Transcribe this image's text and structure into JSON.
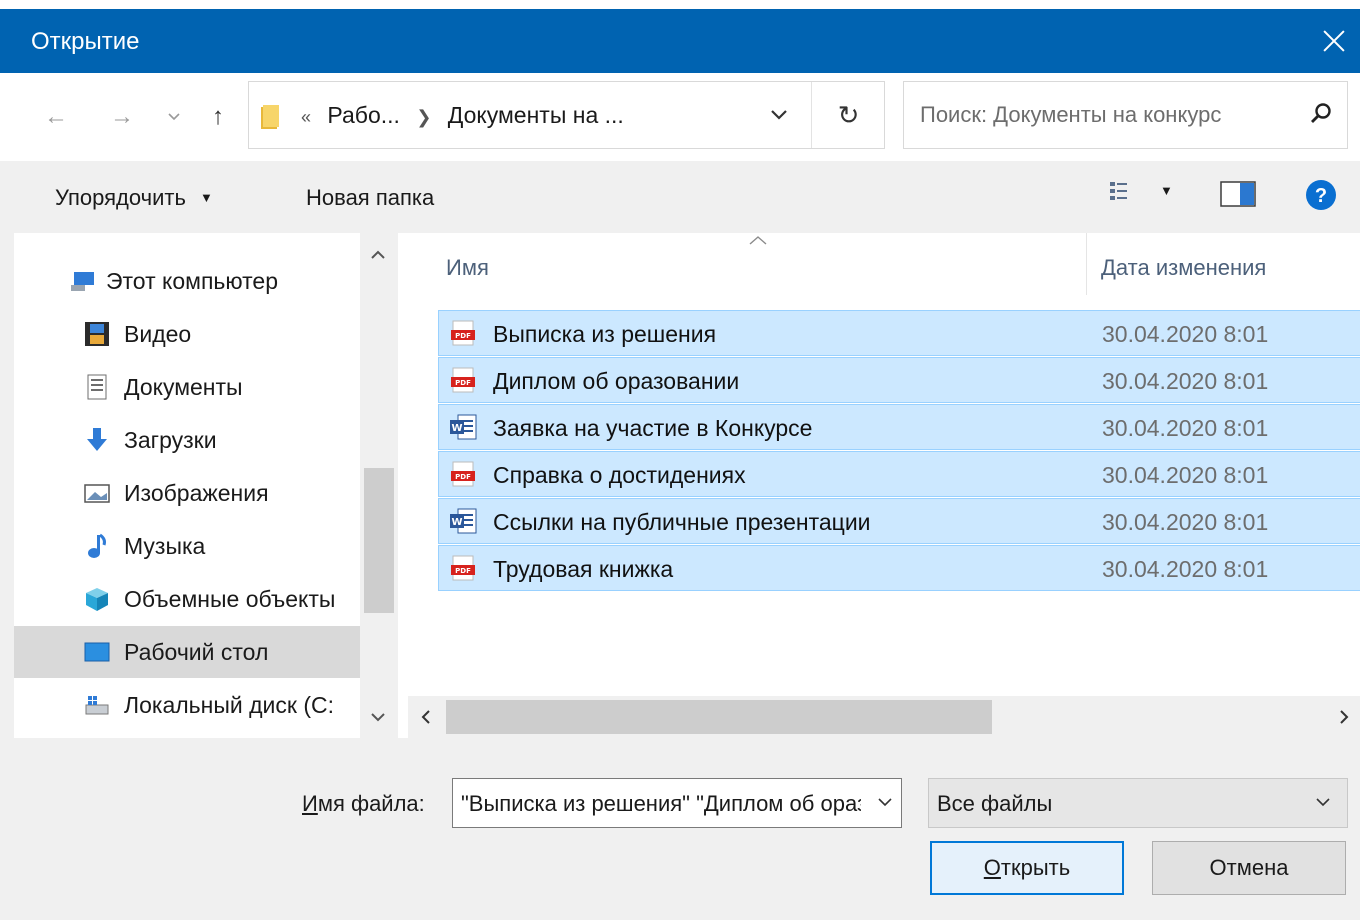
{
  "window": {
    "title": "Открытие"
  },
  "address": {
    "overflow": "«",
    "crumbs": [
      "Рабо...",
      "Документы на ..."
    ]
  },
  "search": {
    "placeholder": "Поиск: Документы на конкурс"
  },
  "toolbar": {
    "organize": "Упорядочить",
    "new_folder": "Новая папка"
  },
  "sidebar": {
    "items": [
      {
        "label": "Этот компьютер",
        "icon": "computer-icon"
      },
      {
        "label": "Видео",
        "icon": "video-icon"
      },
      {
        "label": "Документы",
        "icon": "documents-icon"
      },
      {
        "label": "Загрузки",
        "icon": "downloads-icon"
      },
      {
        "label": "Изображения",
        "icon": "pictures-icon"
      },
      {
        "label": "Музыка",
        "icon": "music-icon"
      },
      {
        "label": "Объемные объекты",
        "icon": "3d-objects-icon"
      },
      {
        "label": "Рабочий стол",
        "icon": "desktop-icon",
        "selected": true
      },
      {
        "label": "Локальный диск (C:",
        "icon": "local-disk-icon"
      }
    ]
  },
  "columns": {
    "name": "Имя",
    "date": "Дата изменения"
  },
  "files": [
    {
      "name": "Выписка из решения",
      "date": "30.04.2020 8:01",
      "type": "pdf"
    },
    {
      "name": "Диплом об оразовании",
      "date": "30.04.2020 8:01",
      "type": "pdf"
    },
    {
      "name": "Заявка на участие в Конкурсе",
      "date": "30.04.2020 8:01",
      "type": "word"
    },
    {
      "name": "Справка о достидениях",
      "date": "30.04.2020 8:01",
      "type": "pdf"
    },
    {
      "name": "Ссылки на публичные презентации",
      "date": "30.04.2020 8:01",
      "type": "word"
    },
    {
      "name": "Трудовая книжка",
      "date": "30.04.2020 8:01",
      "type": "pdf"
    }
  ],
  "footer": {
    "filename_label_mnemonic": "И",
    "filename_label_rest": "мя файла:",
    "filename_value": "\"Выписка из решения\" \"Диплом об оразовании\" \"Заявка на участие в Конкурсе\"",
    "filetype_value": "Все файлы",
    "open_mnemonic": "О",
    "open_rest": "ткрыть",
    "cancel": "Отмена"
  },
  "colors": {
    "titlebar": "#0063b1",
    "selection": "#cce8ff",
    "selection_border": "#99d1ff",
    "accent": "#0078d7",
    "pdf_red": "#d7221d",
    "word_blue": "#2b579a"
  }
}
